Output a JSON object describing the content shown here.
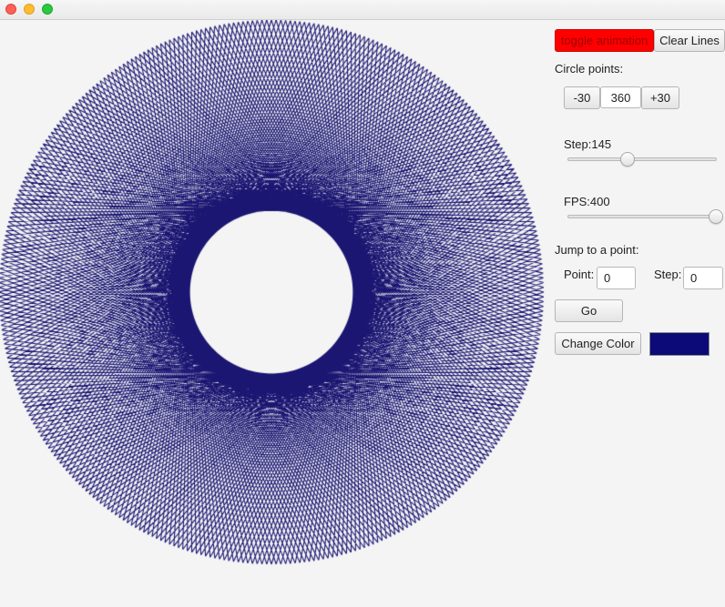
{
  "window": {
    "controls": [
      "close",
      "minimize",
      "maximize"
    ]
  },
  "canvas": {
    "line_color": "#1a1672",
    "circle_points": 360,
    "step": 145
  },
  "panel": {
    "toggle_animation_label": "toggle animation",
    "toggle_animation_color": "#ff0000",
    "clear_lines_label": "Clear Lines",
    "circle_points_label": "Circle points:",
    "minus_label": "-30",
    "points_value": "360",
    "plus_label": "+30",
    "step_label": "Step:",
    "step_value": "145",
    "step_slider": {
      "min": 0,
      "max": 360,
      "value": 145
    },
    "fps_label": "FPS:",
    "fps_value": "400",
    "fps_slider": {
      "min": 0,
      "max": 400,
      "value": 400
    },
    "jump_label": "Jump to a point:",
    "point_label": "Point:",
    "point_value": "0",
    "jump_step_label": "Step:",
    "jump_step_value": "0",
    "go_label": "Go",
    "change_color_label": "Change Color",
    "current_color": "#0b0a78"
  }
}
